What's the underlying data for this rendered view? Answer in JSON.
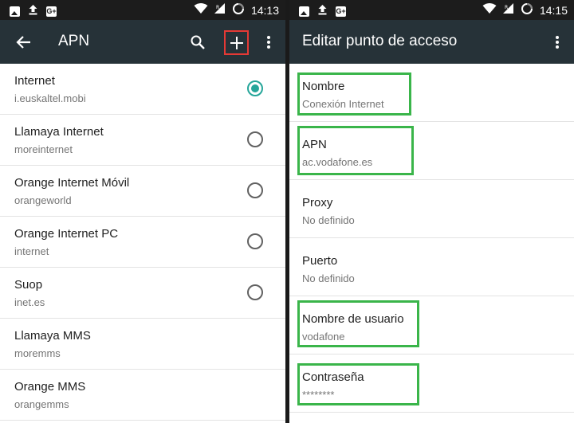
{
  "left": {
    "status_time": "14:13",
    "title": "APN",
    "items": [
      {
        "name": "Internet",
        "apn": "i.euskaltel.mobi",
        "selected": true,
        "radio": true
      },
      {
        "name": "Llamaya Internet",
        "apn": "moreinternet",
        "selected": false,
        "radio": true
      },
      {
        "name": "Orange Internet Móvil",
        "apn": "orangeworld",
        "selected": false,
        "radio": true
      },
      {
        "name": "Orange Internet PC",
        "apn": "internet",
        "selected": false,
        "radio": true
      },
      {
        "name": "Suop",
        "apn": "inet.es",
        "selected": false,
        "radio": true
      },
      {
        "name": "Llamaya MMS",
        "apn": "moremms",
        "selected": false,
        "radio": false
      },
      {
        "name": "Orange MMS",
        "apn": "orangemms",
        "selected": false,
        "radio": false
      }
    ]
  },
  "right": {
    "status_time": "14:15",
    "title": "Editar punto de acceso",
    "fields": [
      {
        "label": "Nombre",
        "value": "Conexión Internet"
      },
      {
        "label": "APN",
        "value": "ac.vodafone.es"
      },
      {
        "label": "Proxy",
        "value": "No definido"
      },
      {
        "label": "Puerto",
        "value": "No definido"
      },
      {
        "label": "Nombre de usuario",
        "value": "vodafone"
      },
      {
        "label": "Contraseña",
        "value": "********"
      }
    ]
  },
  "colors": {
    "toolbar": "#263238",
    "accent": "#26a69a",
    "highlight_green": "#3ab54a",
    "highlight_red": "#e53935"
  }
}
